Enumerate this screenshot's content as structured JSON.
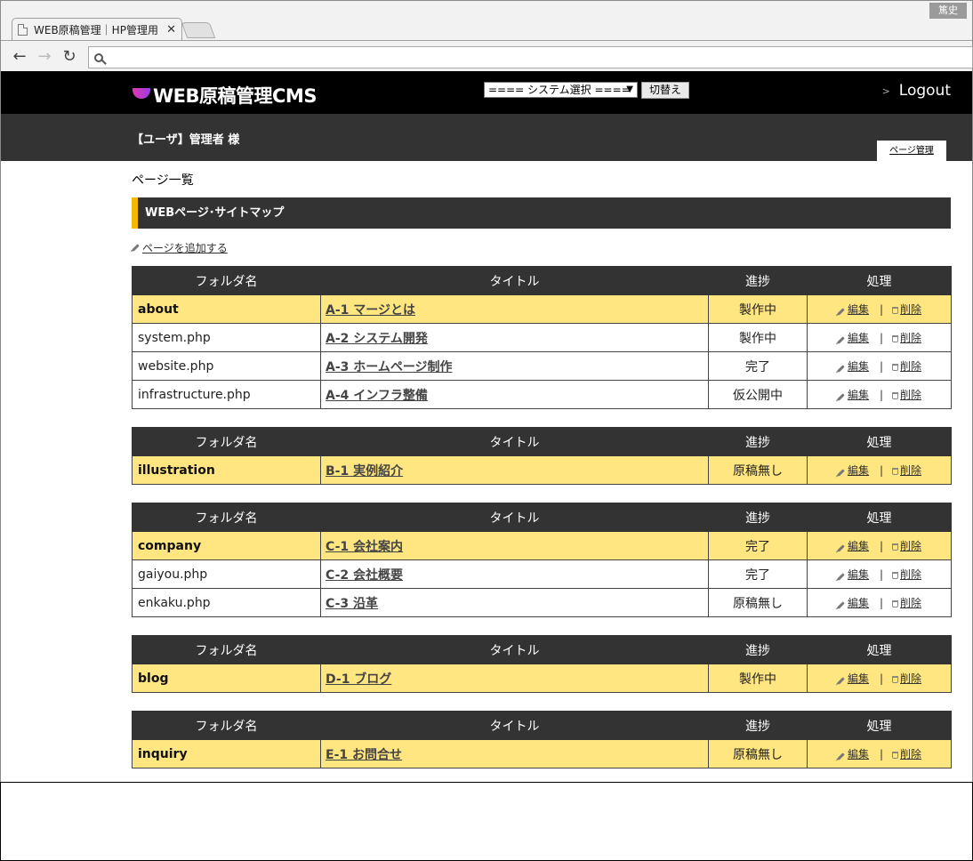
{
  "browser": {
    "user_badge": "篤史",
    "tab_title": "WEB原稿管理｜HP管理用",
    "tab_close": "✕",
    "back": "←",
    "forward": "→",
    "reload": "↻"
  },
  "header": {
    "logo_text": "WEB原稿管理CMS",
    "system_select_value": "==== システム選択 ====",
    "switch_label": "切替え",
    "logout_label": "Logout"
  },
  "user_bar": {
    "user_label": "【ユーザ】管理者 様",
    "tab_label": "ページ管理"
  },
  "content": {
    "page_heading": "ページ一覧",
    "section_title": "WEBページ･サイトマップ",
    "add_page_label": "ページを追加する",
    "columns": [
      "フォルダ名",
      "タイトル",
      "進捗",
      "処理"
    ],
    "edit_label": "編集",
    "delete_label": "削除",
    "separator": "|",
    "groups": [
      {
        "folder": "about",
        "title": "A-1 マージとは",
        "status": "製作中",
        "pages": [
          {
            "file": "system.php",
            "title": "A-2 システム開発",
            "status": "製作中"
          },
          {
            "file": "website.php",
            "title": "A-3 ホームページ制作",
            "status": "完了"
          },
          {
            "file": "infrastructure.php",
            "title": "A-4 インフラ整備",
            "status": "仮公開中"
          }
        ]
      },
      {
        "folder": "illustration",
        "title": "B-1 実例紹介",
        "status": "原稿無し",
        "pages": []
      },
      {
        "folder": "company",
        "title": "C-1 会社案内",
        "status": "完了",
        "pages": [
          {
            "file": "gaiyou.php",
            "title": "C-2 会社概要",
            "status": "完了"
          },
          {
            "file": "enkaku.php",
            "title": "C-3 沿革",
            "status": "原稿無し"
          }
        ]
      },
      {
        "folder": "blog",
        "title": "D-1 ブログ",
        "status": "製作中",
        "pages": []
      },
      {
        "folder": "inquiry",
        "title": "E-1 お問合せ",
        "status": "原稿無し",
        "pages": []
      }
    ]
  }
}
